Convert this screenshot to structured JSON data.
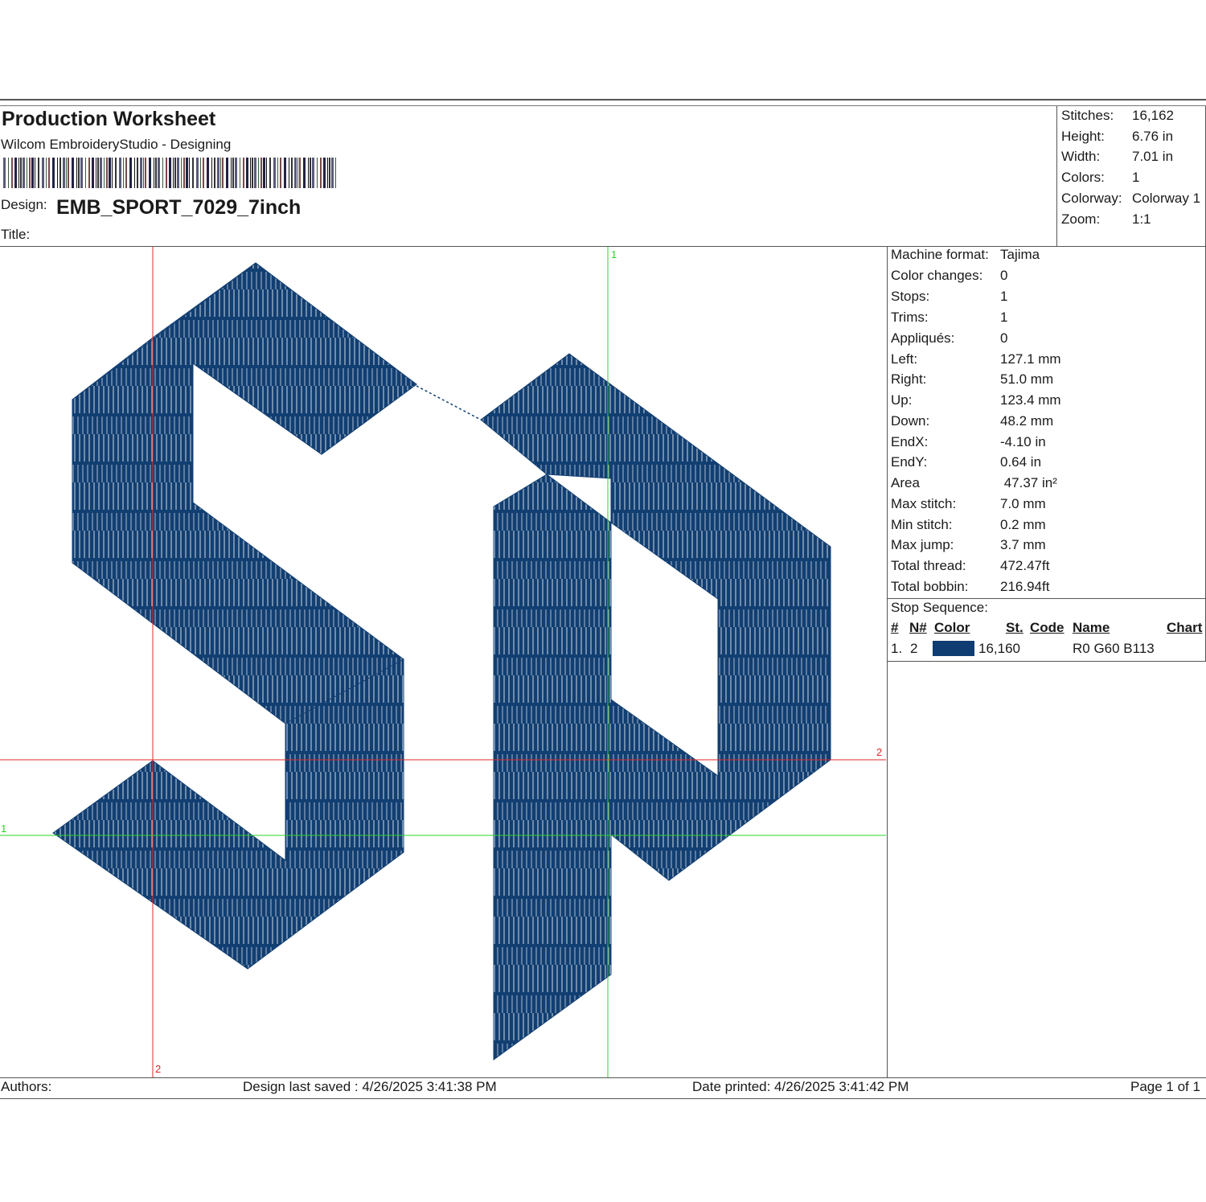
{
  "header": {
    "title": "Production Worksheet",
    "subtitle": "Wilcom EmbroideryStudio - Designing",
    "design_label": "Design:",
    "design_value": "EMB_SPORT_7029_7inch",
    "title_label": "Title:"
  },
  "summary": [
    {
      "label": "Stitches:",
      "value": "16,162"
    },
    {
      "label": "Height:",
      "value": "6.76 in"
    },
    {
      "label": "Width:",
      "value": "7.01 in"
    },
    {
      "label": "Colors:",
      "value": "1"
    },
    {
      "label": "Colorway:",
      "value": "Colorway 1"
    },
    {
      "label": "Zoom:",
      "value": "1:1"
    }
  ],
  "properties": [
    {
      "label": "Machine format:",
      "value": "Tajima"
    },
    {
      "label": "Color changes:",
      "value": "0"
    },
    {
      "label": "Stops:",
      "value": "1"
    },
    {
      "label": "Trims:",
      "value": "1"
    },
    {
      "label": "Appliqués:",
      "value": "0"
    },
    {
      "label": "Left:",
      "value": "127.1 mm"
    },
    {
      "label": "Right:",
      "value": "51.0 mm"
    },
    {
      "label": "Up:",
      "value": "123.4 mm"
    },
    {
      "label": "Down:",
      "value": "48.2 mm"
    },
    {
      "label": "EndX:",
      "value": "-4.10 in"
    },
    {
      "label": "EndY:",
      "value": "0.64 in"
    },
    {
      "label": "Area",
      "value": " 47.37 in²"
    },
    {
      "label": "Max stitch:",
      "value": "7.0 mm"
    },
    {
      "label": "Min stitch:",
      "value": "0.2 mm"
    },
    {
      "label": "Max jump:",
      "value": "3.7 mm"
    },
    {
      "label": "Total thread:",
      "value": "472.47ft"
    },
    {
      "label": "Total bobbin:",
      "value": "216.94ft"
    }
  ],
  "stop_sequence": {
    "title": "Stop Sequence:",
    "columns": {
      "num": "#",
      "n": "N#",
      "color": "Color",
      "st": "St.",
      "code": "Code",
      "name": "Name",
      "chart": "Chart"
    },
    "rows": [
      {
        "num": "1.",
        "n": "2",
        "color": "#0f3c71",
        "st": "16,160",
        "code": "",
        "name": "R0 G60 B113",
        "chart": ""
      }
    ]
  },
  "canvas": {
    "guide_labels": {
      "green_v": "1",
      "green_h": "1",
      "red_h": "2",
      "red_v": "2"
    },
    "thread_color": "#123f72",
    "stitch_highlight": "#cfd8e3",
    "guide_red": "#e0282a",
    "guide_green": "#2ad42a"
  },
  "footer": {
    "authors": "Authors:",
    "last_saved": "Design last saved : 4/26/2025 3:41:38 PM",
    "printed": "Date printed: 4/26/2025 3:41:42 PM",
    "page": "Page 1 of 1"
  }
}
